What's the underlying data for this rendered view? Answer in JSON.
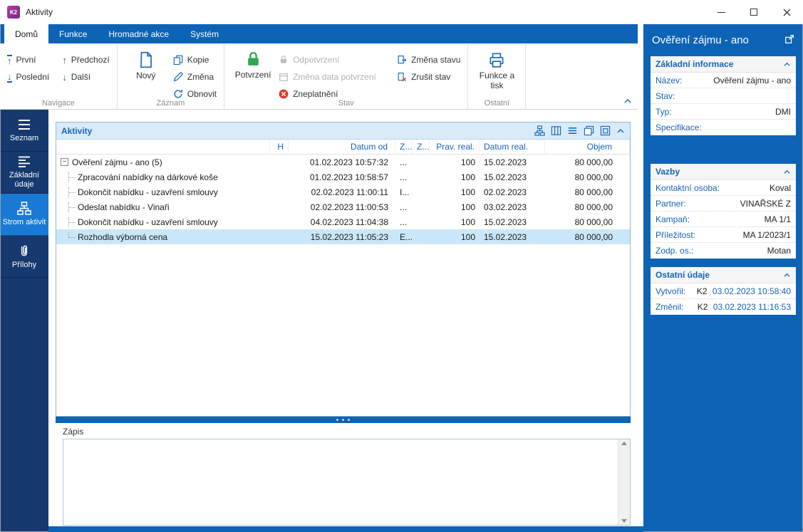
{
  "titlebar": {
    "logo": "K2",
    "title": "Aktivity"
  },
  "icons": {
    "up_arrow": "↑",
    "down_arrow": "↓",
    "minus": "−"
  },
  "ribbon": {
    "tabs": [
      {
        "label": "Domů",
        "active": true
      },
      {
        "label": "Funkce",
        "active": false
      },
      {
        "label": "Hromadné akce",
        "active": false
      },
      {
        "label": "Systém",
        "active": false
      }
    ],
    "navigation": {
      "first": "První",
      "last": "Poslední",
      "prev": "Předchozí",
      "next": "Další"
    },
    "record": {
      "new": "Nový",
      "copy": "Kopie",
      "change": "Změna",
      "refresh": "Obnovit"
    },
    "state": {
      "confirm": "Potvrzení",
      "unconfirm": "Odpotvrzení",
      "change_confirm_date": "Změna data potvrzení",
      "invalidate": "Zneplatnění",
      "change_state": "Změna stavu",
      "cancel_state": "Zrušit stav"
    },
    "other": {
      "functions_print": "Funkce a tisk"
    },
    "group_labels": {
      "navigation": "Navigace",
      "record": "Záznam",
      "state": "Stav",
      "other": "Ostatní"
    }
  },
  "sidebar": {
    "items": [
      {
        "label": "Seznam",
        "active": false
      },
      {
        "label": "Základní údaje",
        "active": false
      },
      {
        "label": "Strom aktivit",
        "active": true
      },
      {
        "label": "Přílohy",
        "active": false
      }
    ]
  },
  "activities": {
    "title": "Aktivity",
    "columns": [
      "",
      "H",
      "Datum od",
      "Z...",
      "Z...",
      "Prav. real.",
      "Datum real.",
      "Objem"
    ],
    "rows": [
      {
        "name": "Ověření zájmu - ano (5)",
        "h": "",
        "datum_od": "01.02.2023 10:57:32",
        "z1": "...",
        "z2": "",
        "prav_real": "100",
        "datum_real": "15.02.2023",
        "objem": "80 000,00"
      },
      {
        "name": "Zpracování nabídky na dárkové koše",
        "h": "",
        "datum_od": "01.02.2023 10:58:57",
        "z1": "...",
        "z2": "",
        "prav_real": "100",
        "datum_real": "15.02.2023",
        "objem": "80 000,00"
      },
      {
        "name": "Dokončit nabídku - uzavření smlouvy",
        "h": "",
        "datum_od": "02.02.2023 11:00:11",
        "z1": "I...",
        "z2": "",
        "prav_real": "100",
        "datum_real": "02.02.2023",
        "objem": "80 000,00"
      },
      {
        "name": "Odeslat nabídku - Vinaři",
        "h": "",
        "datum_od": "02.02.2023 11:00:53",
        "z1": "...",
        "z2": "",
        "prav_real": "100",
        "datum_real": "03.02.2023",
        "objem": "80 000,00"
      },
      {
        "name": "Dokončit nabídku - uzavření smlouvy",
        "h": "",
        "datum_od": "04.02.2023 11:04:38",
        "z1": "...",
        "z2": "",
        "prav_real": "100",
        "datum_real": "15.02.2023",
        "objem": "80 000,00"
      },
      {
        "name": "Rozhodla výborná cena",
        "h": "",
        "datum_od": "15.02.2023 11:05:23",
        "z1": "E...",
        "z2": "",
        "prav_real": "100",
        "datum_real": "15.02.2023",
        "objem": "80 000,00"
      }
    ]
  },
  "zapis": {
    "label": "Zápis",
    "value": ""
  },
  "detail": {
    "title": "Ověření zájmu - ano",
    "basic": {
      "title": "Základní informace",
      "rows": [
        {
          "label": "Název:",
          "value": "Ověření zájmu - ano"
        },
        {
          "label": "Stav:",
          "value": ""
        },
        {
          "label": "Typ:",
          "value": "DMI"
        },
        {
          "label": "Specifikace:",
          "value": ""
        }
      ]
    },
    "links": {
      "title": "Vazby",
      "rows": [
        {
          "label": "Kontaktní osoba:",
          "value": "Koval"
        },
        {
          "label": "Partner:",
          "value": "VINAŘSKÉ Z"
        },
        {
          "label": "Kampaň:",
          "value": "MA 1/1"
        },
        {
          "label": "Příležitost:",
          "value": "MA 1/2023/1"
        },
        {
          "label": "Zodp. os.:",
          "value": "Motan"
        }
      ]
    },
    "other": {
      "title": "Ostatní údaje",
      "rows": [
        {
          "label": "Vytvořil:",
          "user": "K2",
          "value": "03.02.2023 10:58:40"
        },
        {
          "label": "Změnil:",
          "user": "K2",
          "value": "03.02.2023 11:16:53"
        }
      ]
    }
  },
  "colors": {
    "primary": "#0d63b5",
    "sidebar": "#16396f",
    "sidebar_active": "#1a79d4",
    "accent": "#1464ba",
    "selected_row": "#c9e7f8",
    "confirm_green": "#2fa84f",
    "invalid_red": "#d93a2b"
  }
}
